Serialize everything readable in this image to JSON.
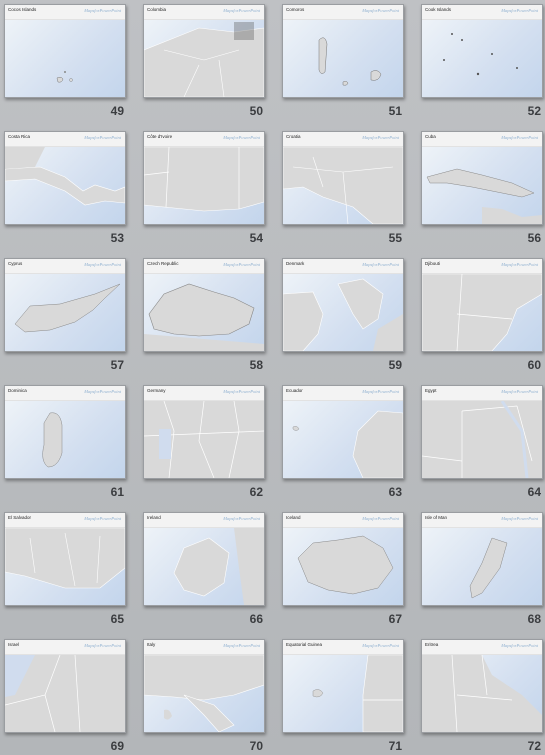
{
  "slide_sorter": {
    "logo_text": "MapsforPowerPoint",
    "slides": [
      {
        "number": "49",
        "title": "Cocos Islands",
        "map": "cocos"
      },
      {
        "number": "50",
        "title": "Colombia",
        "map": "colombia"
      },
      {
        "number": "51",
        "title": "Comoros",
        "map": "comoros"
      },
      {
        "number": "52",
        "title": "Cook Islands",
        "map": "cook"
      },
      {
        "number": "53",
        "title": "Costa Rica",
        "map": "costarica"
      },
      {
        "number": "54",
        "title": "Côte d'Ivoire",
        "map": "ivory"
      },
      {
        "number": "55",
        "title": "Croatia",
        "map": "croatia"
      },
      {
        "number": "56",
        "title": "Cuba",
        "map": "cuba"
      },
      {
        "number": "57",
        "title": "Cyprus",
        "map": "cyprus"
      },
      {
        "number": "58",
        "title": "Czech Republic",
        "map": "czech"
      },
      {
        "number": "59",
        "title": "Denmark",
        "map": "denmark"
      },
      {
        "number": "60",
        "title": "Djibouti",
        "map": "djibouti"
      },
      {
        "number": "61",
        "title": "Dominica",
        "map": "dominica"
      },
      {
        "number": "62",
        "title": "Germany",
        "map": "germany"
      },
      {
        "number": "63",
        "title": "Ecuador",
        "map": "ecuador"
      },
      {
        "number": "64",
        "title": "Egypt",
        "map": "egypt"
      },
      {
        "number": "65",
        "title": "El Salvador",
        "map": "elsalvador"
      },
      {
        "number": "66",
        "title": "Ireland",
        "map": "ireland"
      },
      {
        "number": "67",
        "title": "Iceland",
        "map": "iceland"
      },
      {
        "number": "68",
        "title": "Isle of Man",
        "map": "isleofman"
      },
      {
        "number": "69",
        "title": "Israel",
        "map": "israel"
      },
      {
        "number": "70",
        "title": "Italy",
        "map": "italy"
      },
      {
        "number": "71",
        "title": "Equatorial Guinea",
        "map": "eqguinea"
      },
      {
        "number": "72",
        "title": "Eritrea",
        "map": "eritrea"
      }
    ]
  }
}
